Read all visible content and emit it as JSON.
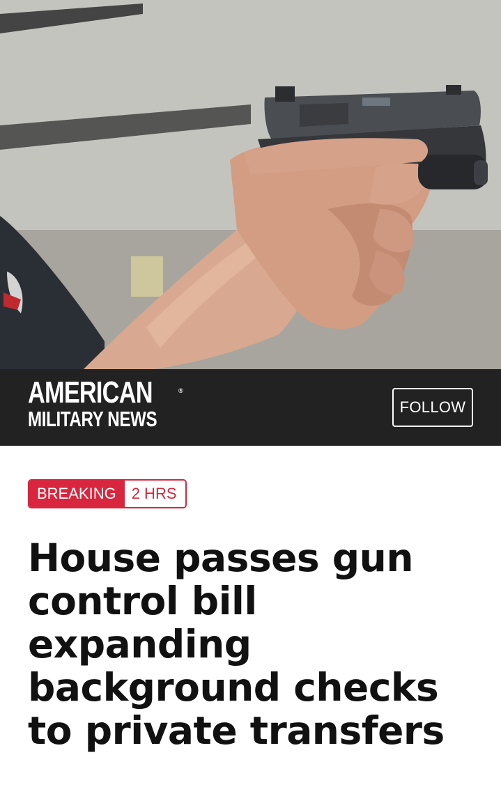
{
  "hero": {
    "alt_subject": "hand-holding-pistol"
  },
  "brand": {
    "line1": "AMERICAN",
    "line2": "MILITARY NEWS",
    "reg_mark": "®",
    "follow_label": "FOLLOW"
  },
  "article": {
    "tag_label": "BREAKING",
    "tag_time": "2 HRS",
    "headline": "House passes gun control bill expanding background checks to private transfers"
  },
  "colors": {
    "brand_bar": "#222222",
    "accent_red": "#d7263d",
    "headline_text": "#111111"
  }
}
